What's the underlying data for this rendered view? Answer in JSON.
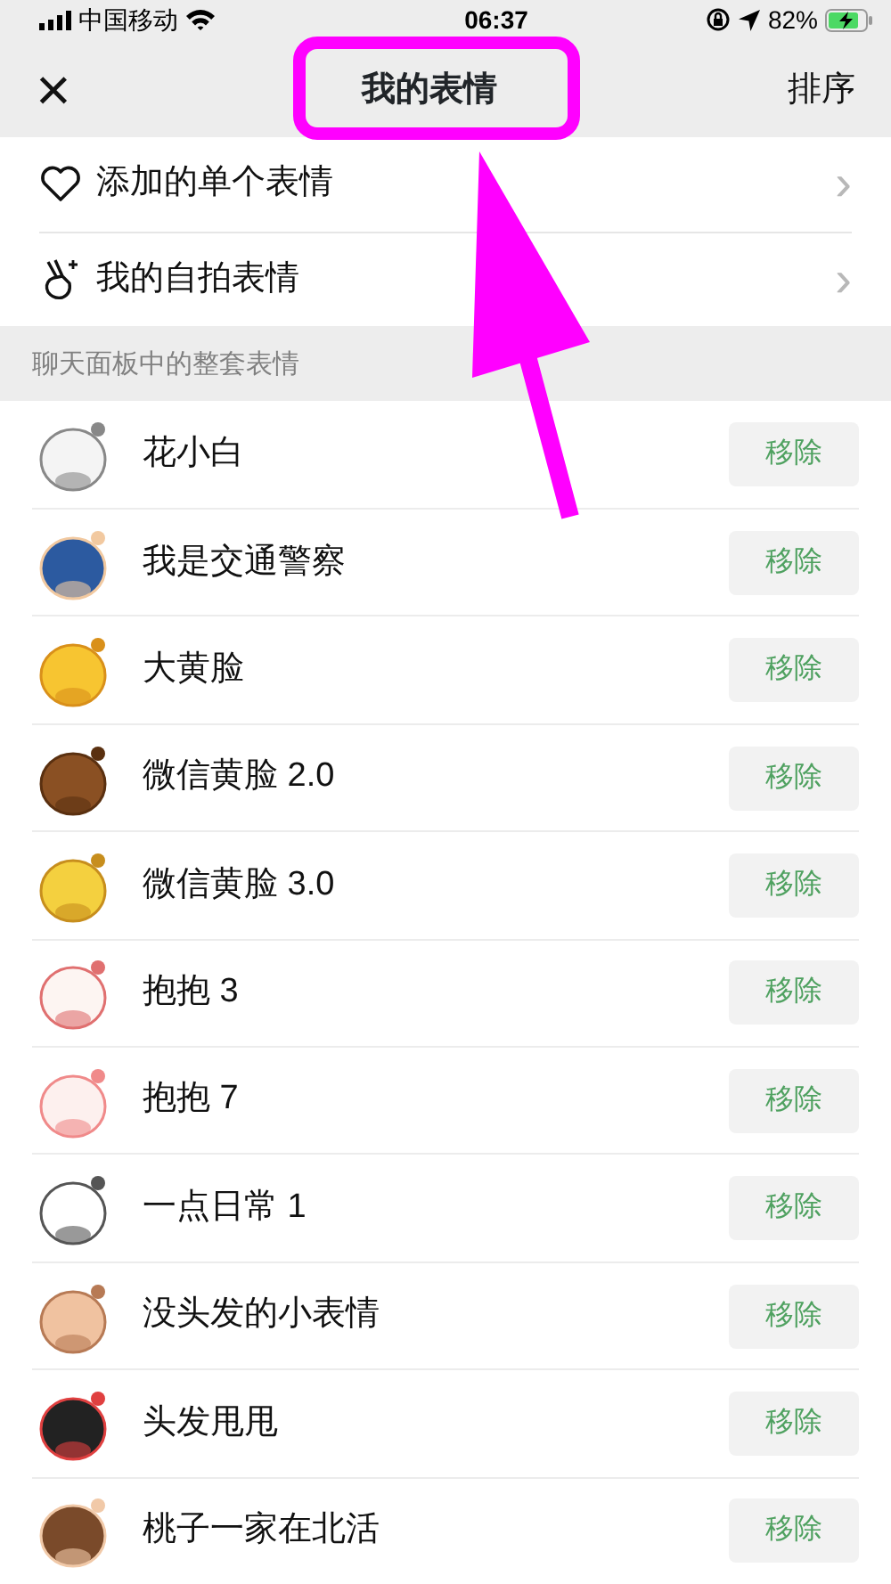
{
  "status_bar": {
    "carrier": "中国移动",
    "time": "06:37",
    "battery": "82%"
  },
  "nav": {
    "close": "×",
    "title": "我的表情",
    "action": "排序"
  },
  "menu": [
    {
      "kind": "heart",
      "label": "添加的单个表情",
      "chevron": "›"
    },
    {
      "kind": "hand",
      "label": "我的自拍表情",
      "chevron": "›"
    }
  ],
  "section_title": "聊天面板中的整套表情",
  "packs": [
    {
      "name": "花小白",
      "button": "移除",
      "kind": "picture"
    },
    {
      "name": "我是交通警察",
      "button": "移除",
      "kind": "picture"
    },
    {
      "name": "大黄脸",
      "button": "移除",
      "kind": "picture"
    },
    {
      "name": "微信黄脸 2.0",
      "button": "移除",
      "kind": "picture"
    },
    {
      "name": "微信黄脸 3.0",
      "button": "移除",
      "kind": "picture"
    },
    {
      "name": "抱抱 3",
      "button": "移除",
      "kind": "picture"
    },
    {
      "name": "抱抱 7",
      "button": "移除",
      "kind": "picture"
    },
    {
      "name": "一点日常 1",
      "button": "移除",
      "kind": "picture"
    },
    {
      "name": "没头发的小表情",
      "button": "移除",
      "kind": "picture"
    },
    {
      "name": "头发甩甩",
      "button": "移除",
      "kind": "picture"
    },
    {
      "name": "桃子一家在北活",
      "button": "移除",
      "kind": "picture"
    }
  ]
}
